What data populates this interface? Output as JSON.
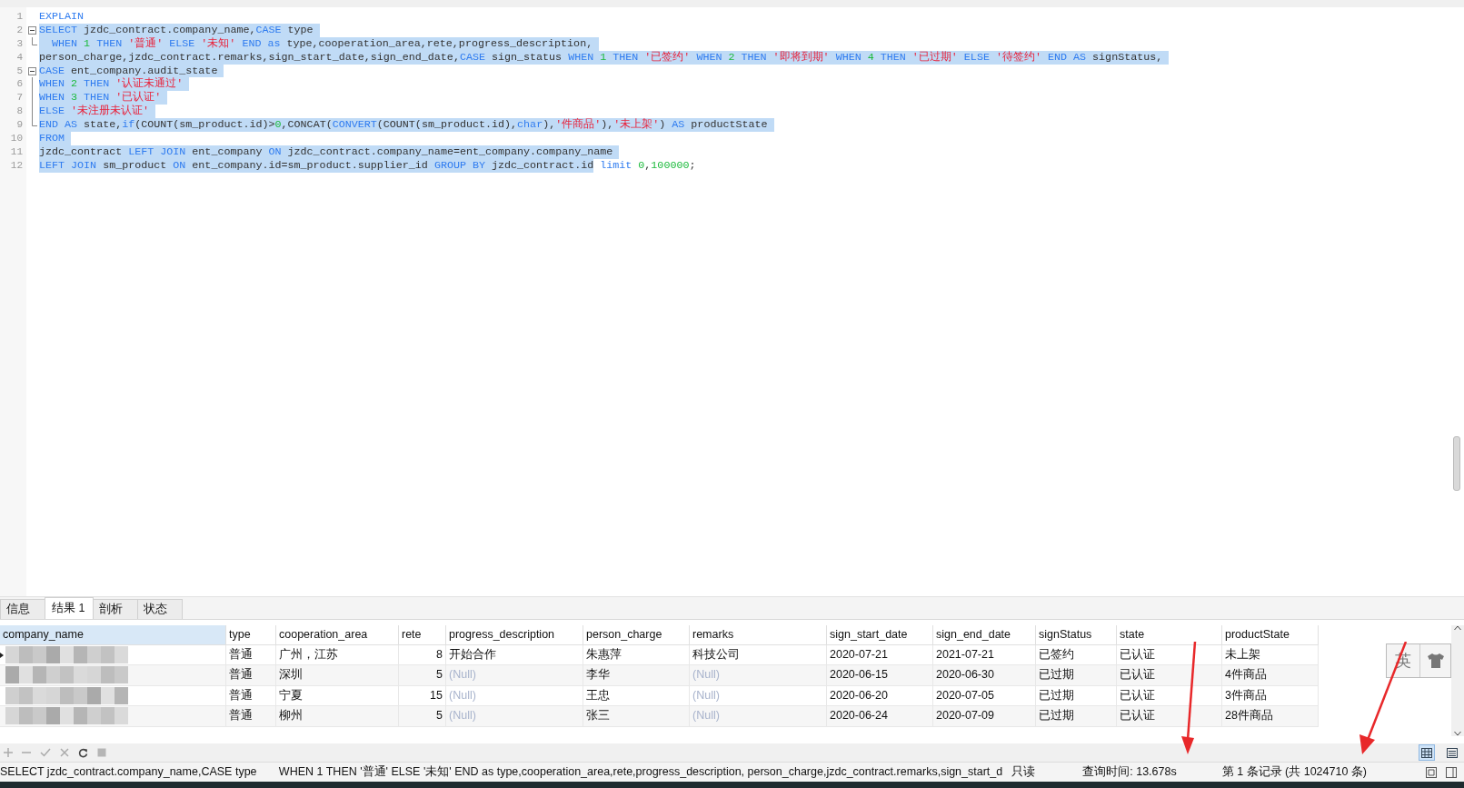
{
  "editor": {
    "lines": [
      {
        "number": "1",
        "segments": [
          {
            "selected": false,
            "tokens": [
              {
                "kind": "kw",
                "text": "EXPLAIN"
              }
            ]
          }
        ]
      },
      {
        "number": "2",
        "fold_start": true,
        "segments": [
          {
            "selected": true,
            "tokens": [
              {
                "kind": "kw",
                "text": "SELECT"
              },
              {
                "kind": "p",
                "text": " jzdc_contract.company_name,"
              },
              {
                "kind": "kw",
                "text": "CASE"
              },
              {
                "kind": "p",
                "text": " type "
              }
            ]
          }
        ]
      },
      {
        "number": "3",
        "fold_end": true,
        "segments": [
          {
            "selected": true,
            "tokens": [
              {
                "kind": "kw",
                "text": "  WHEN "
              },
              {
                "kind": "n",
                "text": "1 "
              },
              {
                "kind": "kw",
                "text": "THEN "
              },
              {
                "kind": "s",
                "text": "'普通' "
              },
              {
                "kind": "kw",
                "text": "ELSE "
              },
              {
                "kind": "s",
                "text": "'未知' "
              },
              {
                "kind": "kw",
                "text": "END as"
              },
              {
                "kind": "p",
                "text": " type,cooperation_area,rete,progress_description, "
              }
            ]
          }
        ]
      },
      {
        "number": "4",
        "segments": [
          {
            "selected": true,
            "tokens": [
              {
                "kind": "p",
                "text": "person_charge,jzdc_contract.remarks,sign_start_date,sign_end_date,"
              },
              {
                "kind": "kw",
                "text": "CASE"
              },
              {
                "kind": "p",
                "text": " sign_status "
              },
              {
                "kind": "kw",
                "text": "WHEN "
              },
              {
                "kind": "n",
                "text": "1 "
              },
              {
                "kind": "kw",
                "text": "THEN "
              },
              {
                "kind": "s",
                "text": "'已签约' "
              },
              {
                "kind": "kw",
                "text": "WHEN "
              },
              {
                "kind": "n",
                "text": "2 "
              },
              {
                "kind": "kw",
                "text": "THEN "
              },
              {
                "kind": "s",
                "text": "'即将到期' "
              },
              {
                "kind": "kw",
                "text": "WHEN "
              },
              {
                "kind": "n",
                "text": "4 "
              },
              {
                "kind": "kw",
                "text": "THEN "
              },
              {
                "kind": "s",
                "text": "'已过期' "
              },
              {
                "kind": "kw",
                "text": "ELSE "
              },
              {
                "kind": "s",
                "text": "'待签约' "
              },
              {
                "kind": "kw",
                "text": "END AS"
              },
              {
                "kind": "p",
                "text": " signStatus, "
              }
            ]
          }
        ]
      },
      {
        "number": "5",
        "fold_start": true,
        "segments": [
          {
            "selected": true,
            "tokens": [
              {
                "kind": "kw",
                "text": "CASE"
              },
              {
                "kind": "p",
                "text": " ent_company.audit_state "
              }
            ]
          }
        ]
      },
      {
        "number": "6",
        "fold_line": true,
        "segments": [
          {
            "selected": true,
            "tokens": [
              {
                "kind": "kw",
                "text": "WHEN "
              },
              {
                "kind": "n",
                "text": "2 "
              },
              {
                "kind": "kw",
                "text": "THEN "
              },
              {
                "kind": "s",
                "text": "'认证未通过' "
              }
            ]
          }
        ]
      },
      {
        "number": "7",
        "fold_line": true,
        "segments": [
          {
            "selected": true,
            "tokens": [
              {
                "kind": "kw",
                "text": "WHEN "
              },
              {
                "kind": "n",
                "text": "3 "
              },
              {
                "kind": "kw",
                "text": "THEN "
              },
              {
                "kind": "s",
                "text": "'已认证' "
              }
            ]
          }
        ]
      },
      {
        "number": "8",
        "fold_line": true,
        "segments": [
          {
            "selected": true,
            "tokens": [
              {
                "kind": "kw",
                "text": "ELSE "
              },
              {
                "kind": "s",
                "text": "'未注册未认证' "
              }
            ]
          }
        ]
      },
      {
        "number": "9",
        "fold_end": true,
        "segments": [
          {
            "selected": true,
            "tokens": [
              {
                "kind": "kw",
                "text": "END AS"
              },
              {
                "kind": "p",
                "text": " state,"
              },
              {
                "kind": "kw",
                "text": "if"
              },
              {
                "kind": "p",
                "text": "(COUNT(sm_product.id)>"
              },
              {
                "kind": "n",
                "text": "0"
              },
              {
                "kind": "p",
                "text": ",CONCAT("
              },
              {
                "kind": "kw",
                "text": "CONVERT"
              },
              {
                "kind": "p",
                "text": "(COUNT(sm_product.id),"
              },
              {
                "kind": "kw",
                "text": "char"
              },
              {
                "kind": "p",
                "text": "),"
              },
              {
                "kind": "s",
                "text": "'件商品'"
              },
              {
                "kind": "p",
                "text": "),"
              },
              {
                "kind": "s",
                "text": "'未上架'"
              },
              {
                "kind": "p",
                "text": ") "
              },
              {
                "kind": "kw",
                "text": "AS"
              },
              {
                "kind": "p",
                "text": " productState "
              }
            ]
          }
        ]
      },
      {
        "number": "10",
        "segments": [
          {
            "selected": true,
            "tokens": [
              {
                "kind": "kw",
                "text": "FROM "
              }
            ]
          }
        ]
      },
      {
        "number": "11",
        "segments": [
          {
            "selected": true,
            "tokens": [
              {
                "kind": "p",
                "text": "jzdc_contract "
              },
              {
                "kind": "kw",
                "text": "LEFT JOIN"
              },
              {
                "kind": "p",
                "text": " ent_company "
              },
              {
                "kind": "kw",
                "text": "ON"
              },
              {
                "kind": "p",
                "text": " jzdc_contract.company_name=ent_company.company_name "
              }
            ]
          }
        ]
      },
      {
        "number": "12",
        "segments": [
          {
            "selected": true,
            "tokens": [
              {
                "kind": "kw",
                "text": "LEFT JOIN"
              },
              {
                "kind": "p",
                "text": " sm_product "
              },
              {
                "kind": "kw",
                "text": "ON"
              },
              {
                "kind": "p",
                "text": " ent_company.id=sm_product.supplier_id "
              },
              {
                "kind": "kw",
                "text": "GROUP BY"
              },
              {
                "kind": "p",
                "text": " jzdc_contract.id"
              }
            ]
          },
          {
            "selected": false,
            "tokens": [
              {
                "kind": "kw",
                "text": " limit "
              },
              {
                "kind": "n",
                "text": "0"
              },
              {
                "kind": "p",
                "text": ","
              },
              {
                "kind": "n",
                "text": "100000"
              },
              {
                "kind": "p",
                "text": ";"
              }
            ]
          }
        ]
      }
    ]
  },
  "tabs": [
    {
      "label": "信息",
      "selected": false
    },
    {
      "label": "结果 1",
      "selected": true
    },
    {
      "label": "剖析",
      "selected": false
    },
    {
      "label": "状态",
      "selected": false
    }
  ],
  "table": {
    "columns": [
      {
        "label": "company_name",
        "selected": true
      },
      {
        "label": "type",
        "selected": false
      },
      {
        "label": "cooperation_area",
        "selected": false
      },
      {
        "label": "rete",
        "selected": false,
        "align_right": true
      },
      {
        "label": "progress_description",
        "selected": false
      },
      {
        "label": "person_charge",
        "selected": false
      },
      {
        "label": "remarks",
        "selected": false
      },
      {
        "label": "sign_start_date",
        "selected": false
      },
      {
        "label": "sign_end_date",
        "selected": false
      },
      {
        "label": "signStatus",
        "selected": false
      },
      {
        "label": "state",
        "selected": false
      },
      {
        "label": "productState",
        "selected": false
      }
    ],
    "rows": [
      {
        "current": true,
        "cells": [
          {
            "kind": "picture"
          },
          "普通",
          "广州，江苏",
          "8",
          "开始合作",
          "朱惠萍",
          "科技公司",
          "2020-07-21",
          "2021-07-21",
          "已签约",
          "已认证",
          "未上架"
        ]
      },
      {
        "current": false,
        "cells": [
          {
            "kind": "picture"
          },
          "普通",
          "深圳",
          "5",
          {
            "text": "(Null)",
            "null": true
          },
          "李华",
          {
            "text": "(Null)",
            "null": true
          },
          "2020-06-15",
          "2020-06-30",
          "已过期",
          "已认证",
          "4件商品"
        ]
      },
      {
        "current": false,
        "cells": [
          {
            "kind": "picture"
          },
          "普通",
          "宁夏",
          "15",
          {
            "text": "(Null)",
            "null": true
          },
          "王忠",
          {
            "text": "(Null)",
            "null": true
          },
          "2020-06-20",
          "2020-07-05",
          "已过期",
          "已认证",
          "3件商品"
        ]
      },
      {
        "current": false,
        "cells": [
          {
            "kind": "picture"
          },
          "普通",
          "柳州",
          "5",
          {
            "text": "(Null)",
            "null": true
          },
          "张三",
          {
            "text": "(Null)",
            "null": true
          },
          "2020-06-24",
          "2020-07-09",
          "已过期",
          "已认证",
          "28件商品"
        ]
      }
    ]
  },
  "ime": {
    "label": "英"
  },
  "toolbar": {
    "view_buttons": [
      {
        "kind": "grid",
        "selected": true
      },
      {
        "kind": "form",
        "selected": false
      }
    ]
  },
  "status_bar": {
    "query": "SELECT jzdc_contract.company_name,CASE type       WHEN 1 THEN '普通' ELSE '未知' END as type,cooperation_area,rete,progress_description, person_charge,jzdc_contract.remarks,sign_start_d",
    "mode": "只读",
    "time": "查询时间: 13.678s",
    "record": "第 1 条记录 (共 1024710 条)"
  }
}
